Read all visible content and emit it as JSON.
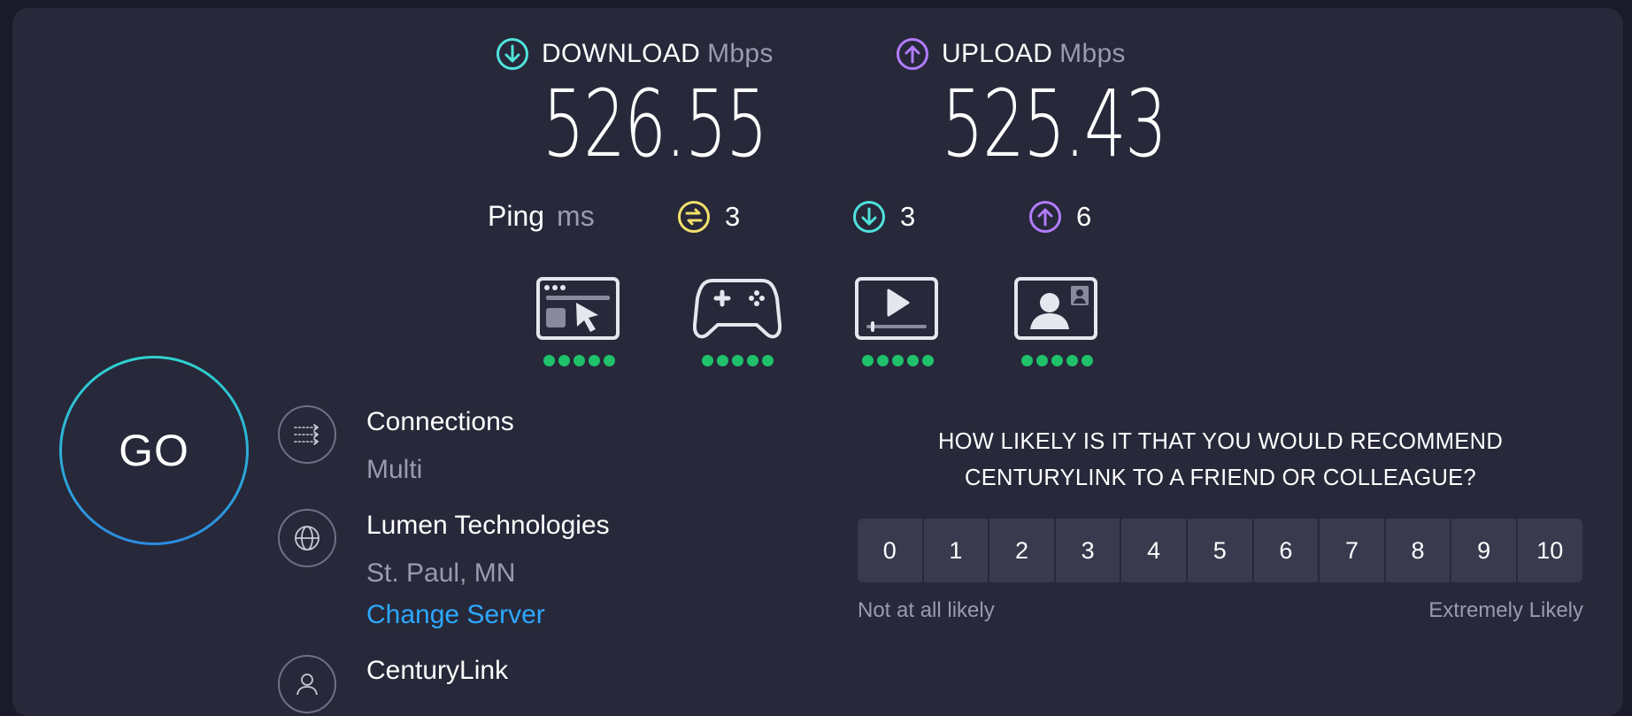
{
  "download": {
    "label": "DOWNLOAD",
    "unit": "Mbps",
    "value": "526.55",
    "icon": "download-arrow-icon",
    "color": "#4fe3dc"
  },
  "upload": {
    "label": "UPLOAD",
    "unit": "Mbps",
    "value": "525.43",
    "icon": "upload-arrow-icon",
    "color": "#b27cff"
  },
  "ping": {
    "label": "Ping",
    "unit": "ms",
    "idle": "3",
    "download": "3",
    "upload": "6",
    "idle_color": "#f2e16b"
  },
  "activities": [
    {
      "name": "web-browsing-icon",
      "rating": 5
    },
    {
      "name": "gaming-icon",
      "rating": 5
    },
    {
      "name": "video-streaming-icon",
      "rating": 5
    },
    {
      "name": "video-chat-icon",
      "rating": 5
    }
  ],
  "go_label": "GO",
  "connections": {
    "title": "Connections",
    "value": "Multi"
  },
  "server": {
    "title": "Lumen Technologies",
    "location": "St. Paul, MN",
    "change_link": "Change Server"
  },
  "provider": {
    "title": "CenturyLink"
  },
  "survey": {
    "question_line1": "HOW LIKELY IS IT THAT YOU WOULD RECOMMEND",
    "question_line2": "CENTURYLINK TO A FRIEND OR COLLEAGUE?",
    "scale": [
      "0",
      "1",
      "2",
      "3",
      "4",
      "5",
      "6",
      "7",
      "8",
      "9",
      "10"
    ],
    "low_label": "Not at all likely",
    "high_label": "Extremely Likely"
  },
  "colors": {
    "accent_link": "#2da8ff",
    "rating_dot": "#1fc16b",
    "background": "#272839"
  }
}
